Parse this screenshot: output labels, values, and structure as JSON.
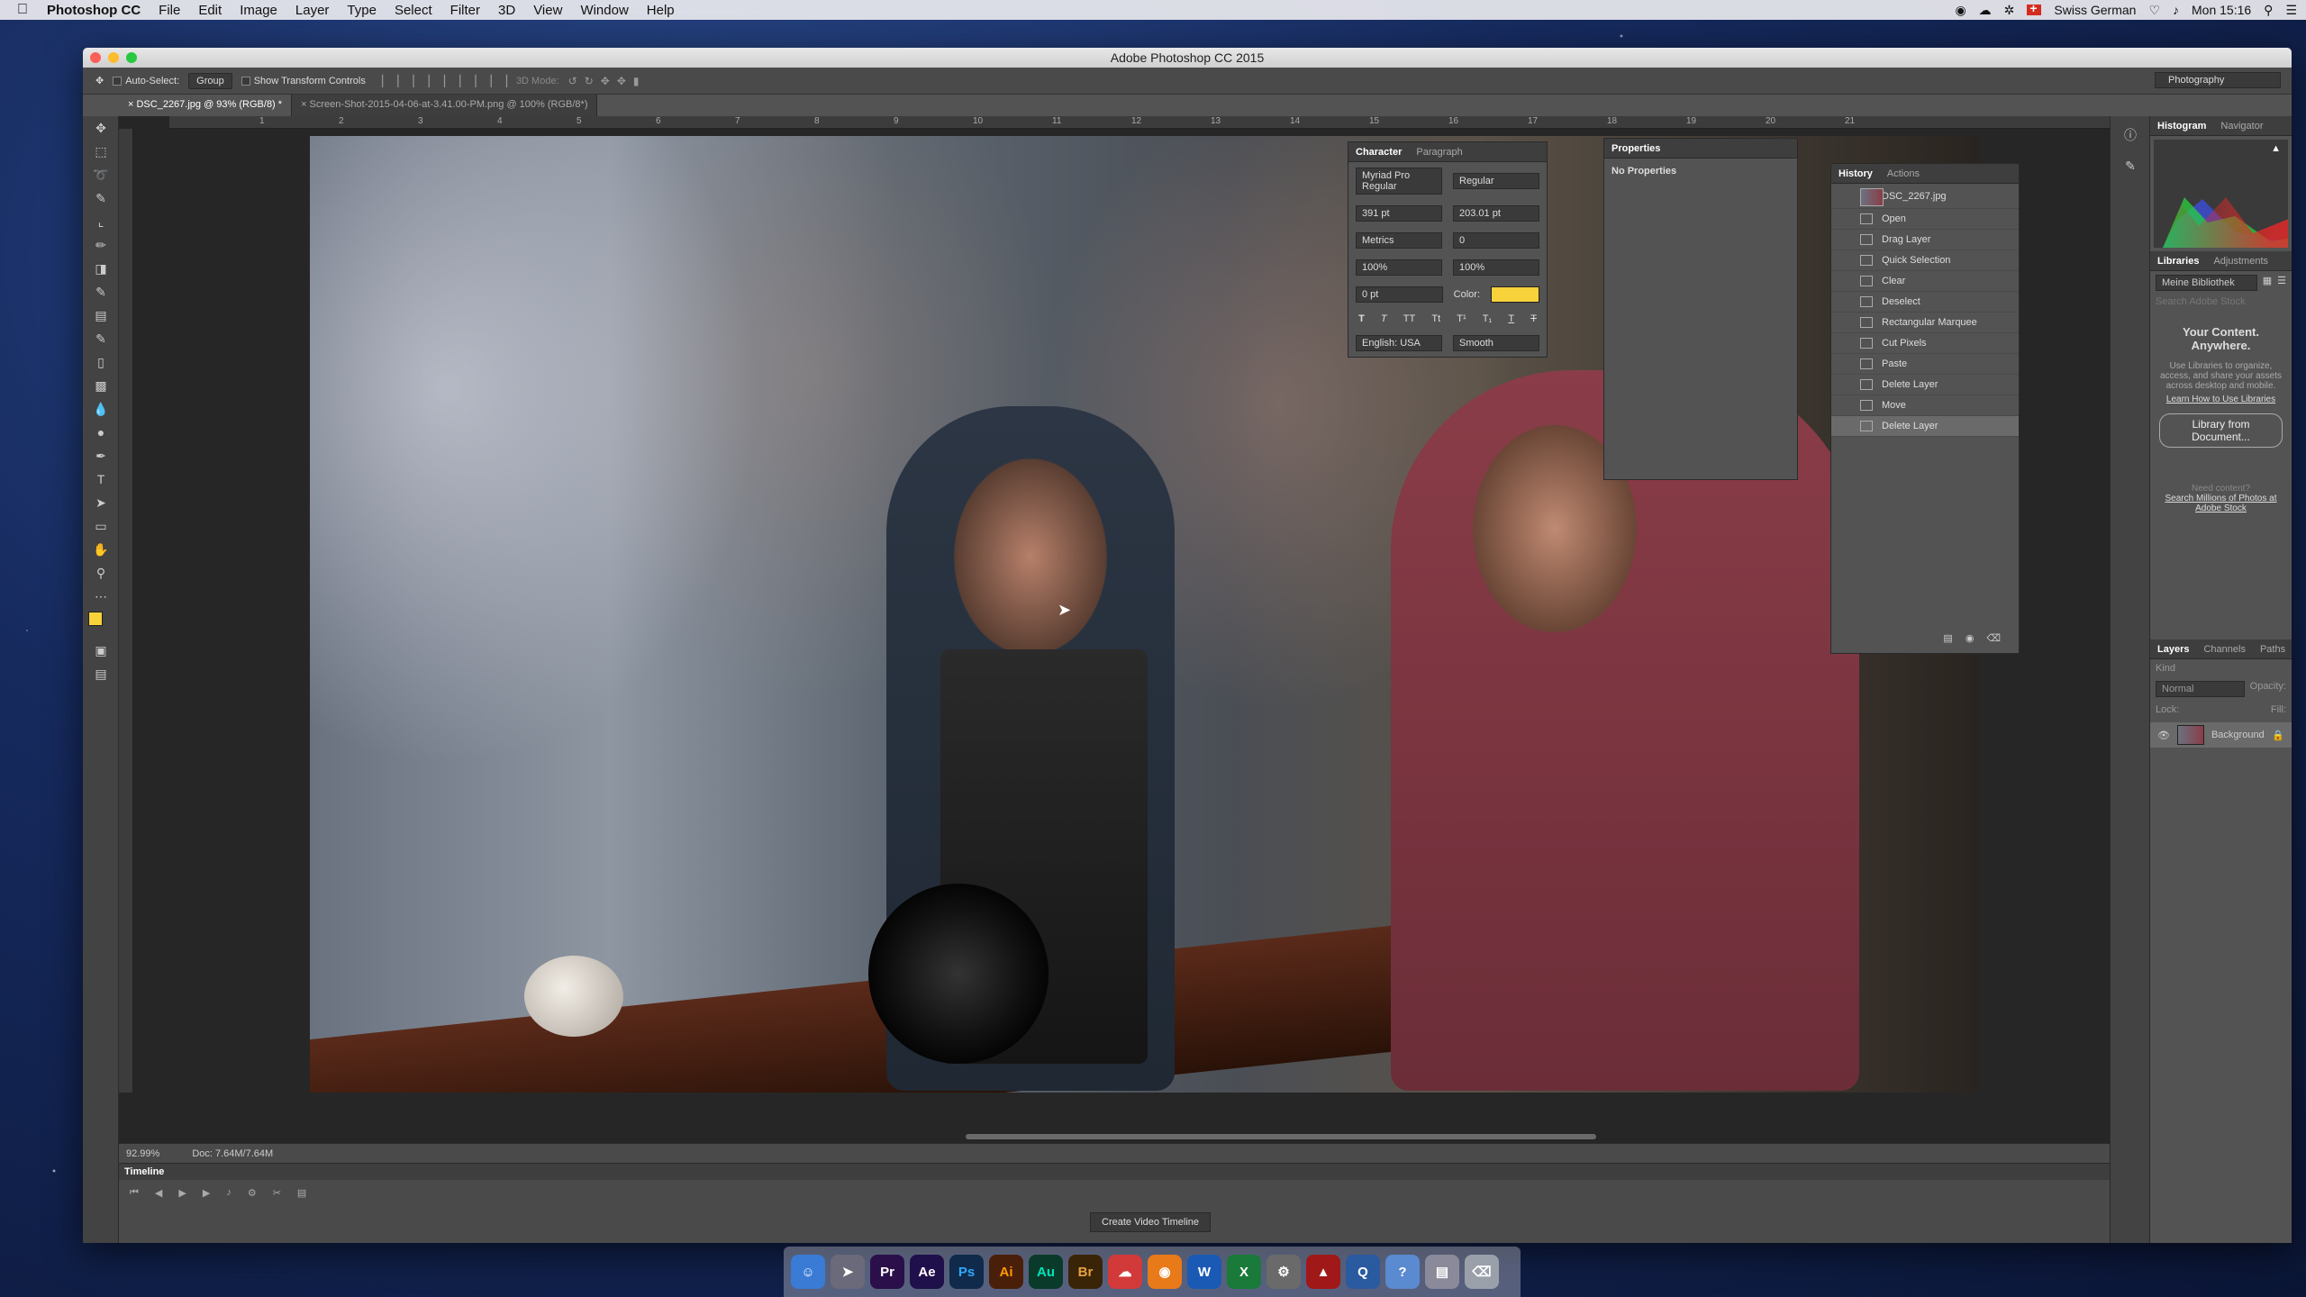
{
  "menubar": {
    "app_name": "Photoshop CC",
    "items": [
      "File",
      "Edit",
      "Image",
      "Layer",
      "Type",
      "Select",
      "Filter",
      "3D",
      "View",
      "Window",
      "Help"
    ],
    "input_source": "Swiss German",
    "clock": "Mon 15:16"
  },
  "window": {
    "title": "Adobe Photoshop CC 2015"
  },
  "options_bar": {
    "auto_select_label": "Auto-Select:",
    "auto_select_value": "Group",
    "show_transform_label": "Show Transform Controls",
    "mode_3d_label": "3D Mode:",
    "workspace": "Photography"
  },
  "documents": {
    "tabs": [
      {
        "label": "DSC_2267.jpg @ 93% (RGB/8) *"
      },
      {
        "label": "Screen-Shot-2015-04-06-at-3.41.00-PM.png @ 100% (RGB/8*)"
      }
    ]
  },
  "ruler": {
    "h_ticks": [
      "1",
      "2",
      "3",
      "4",
      "5",
      "6",
      "7",
      "8",
      "9",
      "10",
      "11",
      "12",
      "13",
      "14",
      "15",
      "16",
      "17",
      "18",
      "19",
      "20",
      "21"
    ]
  },
  "status": {
    "zoom": "92.99%",
    "doc_size": "Doc: 7.64M/7.64M"
  },
  "character_panel": {
    "tab_character": "Character",
    "tab_paragraph": "Paragraph",
    "font_family": "Myriad Pro Regular",
    "font_style": "Regular",
    "font_size": "391 pt",
    "leading": "203.01 pt",
    "kerning": "Metrics",
    "tracking": "0",
    "vertical_scale": "100%",
    "horizontal_scale": "100%",
    "baseline_shift": "0 pt",
    "color_label": "Color:",
    "color_hex": "#f8d23a",
    "language": "English: USA",
    "antialias": "Smooth"
  },
  "properties_panel": {
    "title": "Properties",
    "empty_text": "No Properties"
  },
  "history_panel": {
    "tab_history": "History",
    "tab_actions": "Actions",
    "snapshot": "DSC_2267.jpg",
    "items": [
      {
        "label": "Open"
      },
      {
        "label": "Drag Layer"
      },
      {
        "label": "Quick Selection"
      },
      {
        "label": "Clear"
      },
      {
        "label": "Deselect"
      },
      {
        "label": "Rectangular Marquee"
      },
      {
        "label": "Cut Pixels"
      },
      {
        "label": "Paste"
      },
      {
        "label": "Delete Layer"
      },
      {
        "label": "Move"
      },
      {
        "label": "Delete Layer"
      }
    ]
  },
  "right_dock": {
    "tab_histogram": "Histogram",
    "tab_navigator": "Navigator",
    "tab_libraries": "Libraries",
    "tab_adjustments": "Adjustments",
    "library_select": "Meine Bibliothek",
    "search_placeholder": "Search Adobe Stock",
    "lib_heading": "Your Content. Anywhere.",
    "lib_body": "Use Libraries to organize, access, and share your assets across desktop and mobile.",
    "lib_link": "Learn How to Use Libraries",
    "lib_button": "Library from Document...",
    "need_content": "Need content?",
    "stock_link": "Search Millions of Photos at Adobe Stock",
    "tab_layers": "Layers",
    "tab_channels": "Channels",
    "tab_paths": "Paths",
    "kind_filter": "Kind",
    "blend_mode": "Normal",
    "opacity_label": "Opacity:",
    "lock_label": "Lock:",
    "fill_label": "Fill:",
    "layer_name": "Background"
  },
  "timeline": {
    "title": "Timeline",
    "create_button": "Create Video Timeline"
  },
  "dock_apps": [
    {
      "label": "Pr",
      "color": "#2a0f4a"
    },
    {
      "label": "Ae",
      "color": "#1f0f4a"
    },
    {
      "label": "Ps",
      "color": "#0f2a4a"
    },
    {
      "label": "Ai",
      "color": "#4a1f0a"
    },
    {
      "label": "Au",
      "color": "#0a3a2a"
    },
    {
      "label": "Br",
      "color": "#3a2408"
    }
  ]
}
